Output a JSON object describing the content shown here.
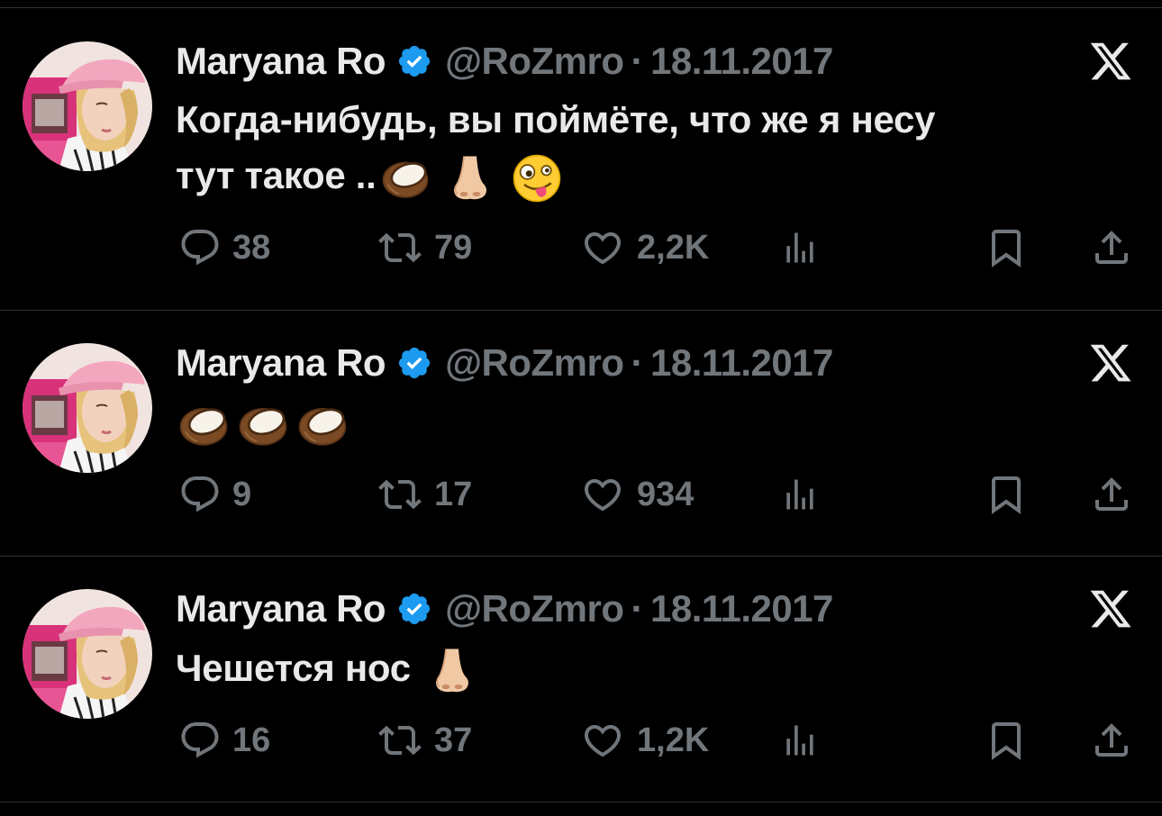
{
  "tweets": [
    {
      "author_name": "Maryana Ro",
      "handle": "@RoZmro",
      "separator": "·",
      "date": "18.11.2017",
      "text_line1": "Когда-нибудь, вы поймёте, что же я несу",
      "text_line2": "тут такое ..",
      "emojis": [
        "coconut",
        "nose",
        "zany-face"
      ],
      "replies": "38",
      "reposts": "79",
      "likes": "2,2K"
    },
    {
      "author_name": "Maryana Ro",
      "handle": "@RoZmro",
      "separator": "·",
      "date": "18.11.2017",
      "text_line1": "",
      "emojis": [
        "coconut",
        "coconut",
        "coconut"
      ],
      "replies": "9",
      "reposts": "17",
      "likes": "934"
    },
    {
      "author_name": "Maryana Ro",
      "handle": "@RoZmro",
      "separator": "·",
      "date": "18.11.2017",
      "text_line1": "Чешется нос",
      "emojis": [
        "nose"
      ],
      "replies": "16",
      "reposts": "37",
      "likes": "1,2K"
    }
  ],
  "icons": {
    "verified": "verified-badge-icon",
    "brand": "x-logo-icon",
    "reply": "reply-icon",
    "repost": "repost-icon",
    "like": "like-icon",
    "views": "views-icon",
    "bookmark": "bookmark-icon",
    "share": "share-icon"
  },
  "colors": {
    "background": "#000000",
    "primary_text": "#e7e9ea",
    "secondary_text": "#71767b",
    "verified_blue": "#1d9bf0",
    "divider": "#2f3336",
    "avatar_cap_pink": "#f3a7bf"
  }
}
